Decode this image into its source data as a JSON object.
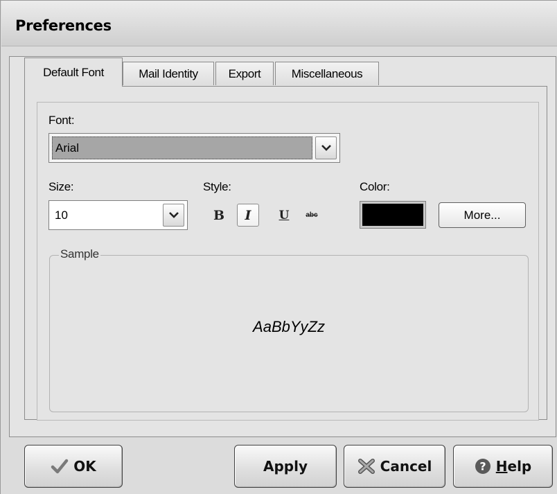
{
  "window": {
    "title": "Preferences"
  },
  "tabs": [
    {
      "label": "Default Font",
      "active": true
    },
    {
      "label": "Mail Identity",
      "active": false
    },
    {
      "label": "Export",
      "active": false
    },
    {
      "label": "Miscellaneous",
      "active": false
    }
  ],
  "font": {
    "label": "Font:",
    "value": "Arial"
  },
  "size": {
    "label": "Size:",
    "value": "10"
  },
  "style": {
    "label": "Style:",
    "bold": "B",
    "italic": "I",
    "underline": "U",
    "strike": "abc",
    "italic_pressed": true
  },
  "color": {
    "label": "Color:",
    "value": "#000000",
    "more_label": "More..."
  },
  "sample": {
    "legend": "Sample",
    "text": "AaBbYyZz"
  },
  "buttons": {
    "ok": "OK",
    "apply": "Apply",
    "cancel": "Cancel",
    "help_mnemonic": "H",
    "help_rest": "elp"
  },
  "icons": {
    "ok": "checkmark-icon",
    "cancel": "x-icon",
    "help": "question-icon",
    "dropdown": "chevron-down-icon"
  }
}
